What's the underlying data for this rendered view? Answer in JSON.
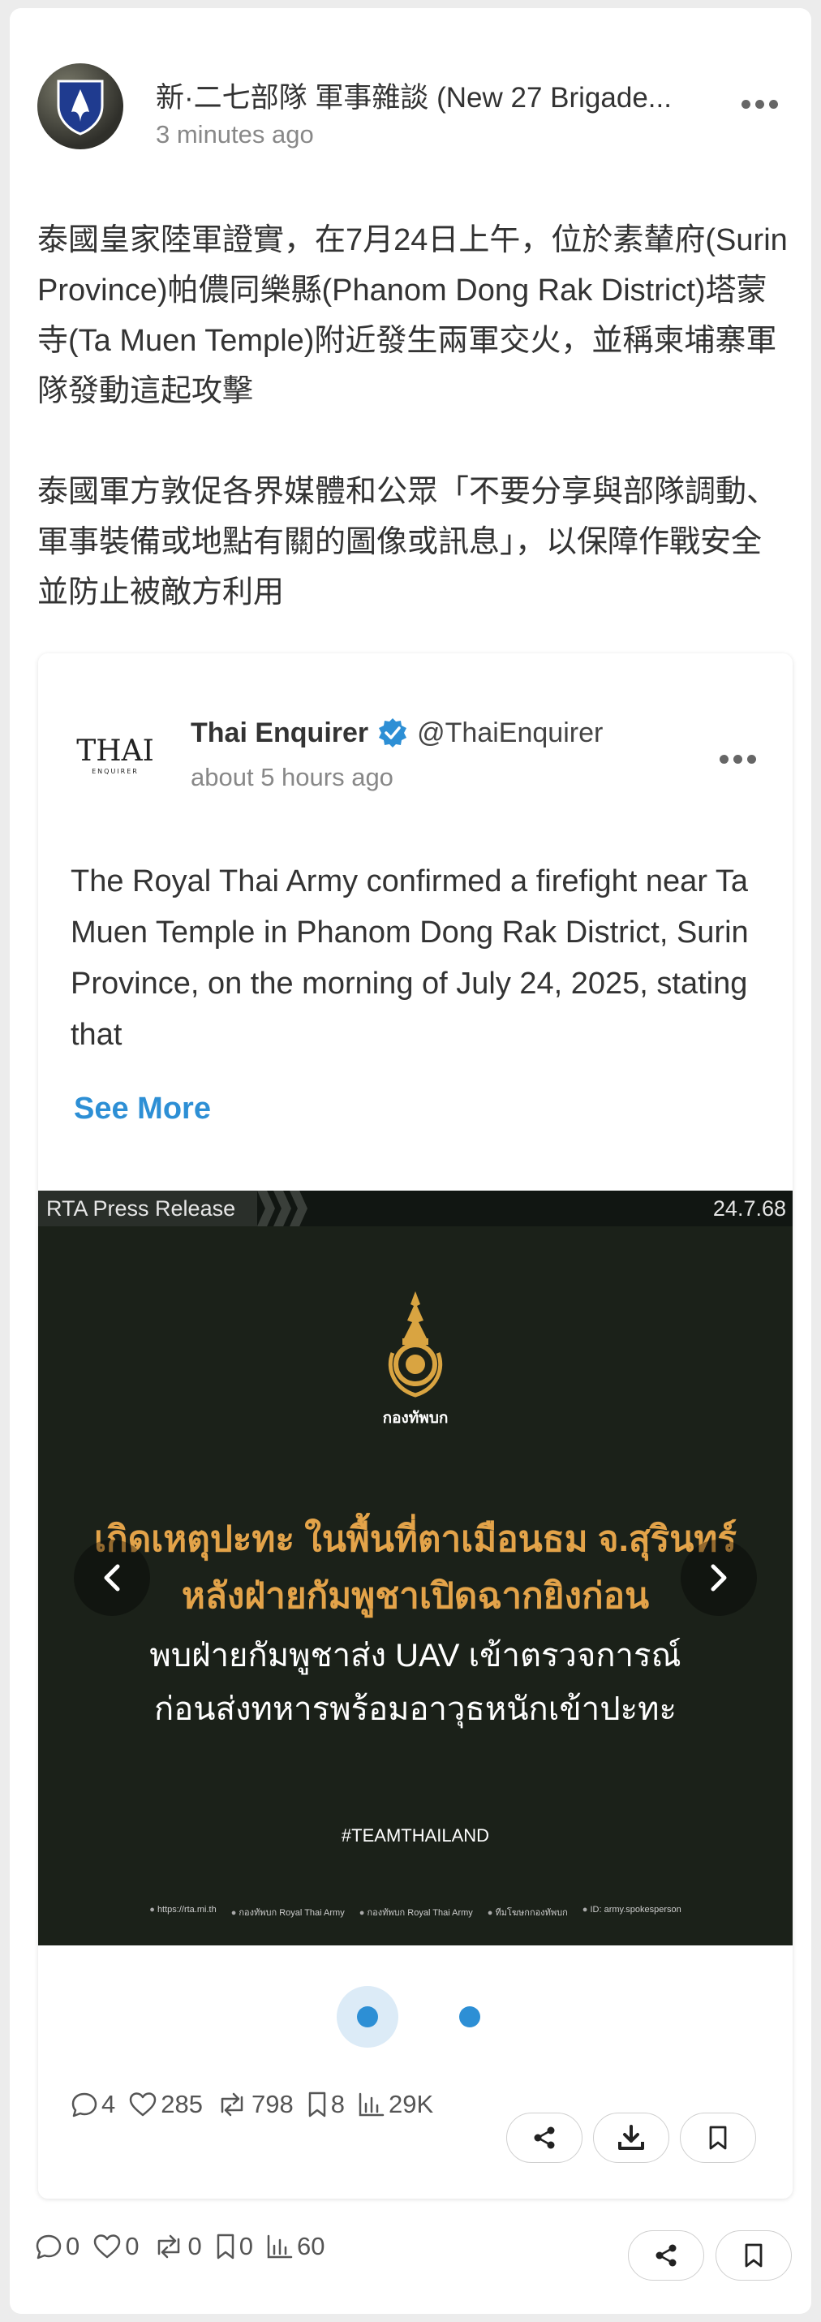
{
  "post": {
    "author": "新·二七部隊 軍事雜談 (New 27 Brigade...",
    "time": "3 minutes ago",
    "paragraphs": [
      "泰國皇家陸軍證實，在7月24日上午，位於素輦府(Surin Province)帕儂同樂縣(Phanom Dong Rak District)塔蒙寺(Ta Muen Temple)附近發生兩軍交火，並稱柬埔寨軍隊發動這起攻擊",
      "泰國軍方敦促各界媒體和公眾「不要分享與部隊調動、軍事裝備或地點有關的圖像或訊息」，以保障作戰安全並防止被敵方利用"
    ],
    "stats": {
      "comments": "0",
      "likes": "0",
      "reposts": "0",
      "bookmarks": "0",
      "views": "60"
    }
  },
  "quote": {
    "logo_text": "THAI",
    "logo_sub": "ENQUIRER",
    "name": "Thai Enquirer",
    "handle": "@ThaiEnquirer",
    "time": "about 5 hours ago",
    "text": "The Royal Thai Army confirmed a firefight near Ta Muen Temple in Phanom Dong Rak District, Surin Province, on the morning of July 24, 2025, stating that",
    "see_more": "See More",
    "image": {
      "bar_label": "RTA Press Release",
      "date": "24.7.68",
      "emblem_label": "กองทัพบก",
      "headline_1": "เกิดเหตุปะทะ ในพื้นที่ตาเมือนธม จ.สุรินทร์",
      "headline_2": "หลังฝ่ายกัมพูชาเปิดฉากยิงก่อน",
      "sub_1": "พบฝ่ายกัมพูชาส่ง UAV เข้าตรวจการณ์",
      "sub_2": "ก่อนส่งทหารพร้อมอาวุธหนักเข้าปะทะ",
      "hashtag": "#TEAMTHAILAND",
      "footer": [
        "https://rta.mi.th",
        "กองทัพบก Royal Thai Army",
        "กองทัพบก Royal Thai Army",
        "ทีมโฆษกกองทัพบก",
        "ID: army.spokesperson"
      ]
    },
    "stats": {
      "comments": "4",
      "likes": "285",
      "reposts": "798",
      "bookmarks": "8",
      "views": "29K"
    }
  },
  "colors": {
    "accent": "#2d8fd5",
    "headline": "#e3a349",
    "image_bg": "#1b2119"
  }
}
